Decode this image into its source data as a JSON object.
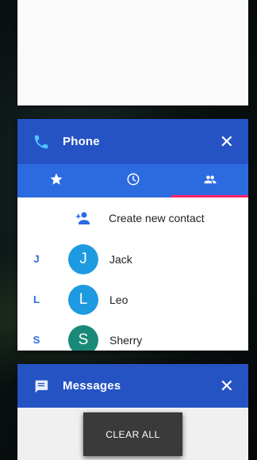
{
  "recents": {
    "phone": {
      "title": "Phone",
      "close_glyph": "✕",
      "icon": "phone-icon",
      "accent": "#2553c4",
      "tabs": [
        {
          "icon": "star-icon",
          "name": "favorites"
        },
        {
          "icon": "clock-icon",
          "name": "recents"
        },
        {
          "icon": "contacts-icon",
          "name": "contacts",
          "selected": true
        }
      ],
      "tab_indicator_color": "#ff1f6b",
      "create_contact_label": "Create new contact",
      "contacts": [
        {
          "section": "J",
          "initial": "J",
          "name": "Jack",
          "color": "#1e9be0"
        },
        {
          "section": "L",
          "initial": "L",
          "name": "Leo",
          "color": "#1e9be0"
        },
        {
          "section": "S",
          "initial": "S",
          "name": "Sherry",
          "color": "#1a8a78"
        }
      ]
    },
    "messages": {
      "title": "Messages",
      "close_glyph": "✕",
      "icon": "message-icon"
    },
    "clear_all_label": "CLEAR ALL"
  }
}
